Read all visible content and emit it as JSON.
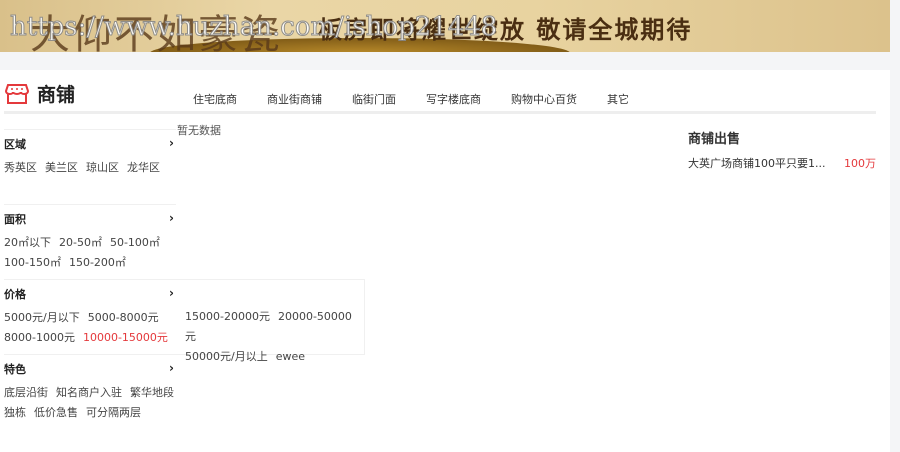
{
  "banner": {
    "calligraphy": "大仰不如豪瓷",
    "slogan": "板房即将耀世绽放 敬请全城期待",
    "watermark": "https://www.huzhan.com/ishop21448"
  },
  "header": {
    "title": "商铺",
    "tabs": [
      "住宅底商",
      "商业街商铺",
      "临街门面",
      "写字楼底商",
      "购物中心百货",
      "其它"
    ]
  },
  "main": {
    "empty_text": "暂无数据"
  },
  "filters": {
    "region": {
      "title": "区域",
      "options": [
        "秀英区",
        "美兰区",
        "琼山区",
        "龙华区"
      ]
    },
    "area": {
      "title": "面积",
      "options": [
        "20㎡以下",
        "20-50㎡",
        "50-100㎡",
        "100-150㎡",
        "150-200㎡"
      ]
    },
    "price": {
      "title": "价格",
      "options": [
        "5000元/月以下",
        "5000-8000元",
        "8000-1000元",
        "10000-15000元"
      ],
      "selected": "10000-15000元",
      "more": [
        "15000-20000元",
        "20000-50000元",
        "50000元/月以上",
        "ewee"
      ]
    },
    "feature": {
      "title": "特色",
      "options": [
        "底层沿街",
        "知名商户入驻",
        "繁华地段",
        "独栋",
        "低价急售",
        "可分隔两层"
      ]
    }
  },
  "sidebar": {
    "title": "商铺出售",
    "items": [
      {
        "name": "大英广场商铺100平只要1...",
        "price": "100万"
      }
    ]
  },
  "colors": {
    "accent": "#e4393c"
  }
}
